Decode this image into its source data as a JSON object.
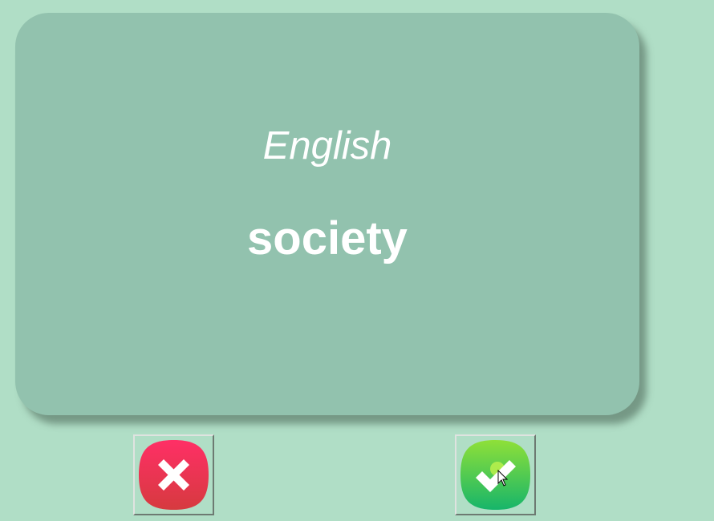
{
  "card": {
    "language": "English",
    "word": "society"
  },
  "buttons": {
    "wrong": {
      "icon": "x-mark-icon",
      "color_top": "#ff2f66",
      "color_bottom": "#d63a3f"
    },
    "right": {
      "icon": "checkmark-icon",
      "color_top": "#8fe038",
      "color_bottom": "#16b56a"
    }
  },
  "colors": {
    "background": "#b0dec6",
    "card": "#92c2ae",
    "text": "#ffffff"
  }
}
